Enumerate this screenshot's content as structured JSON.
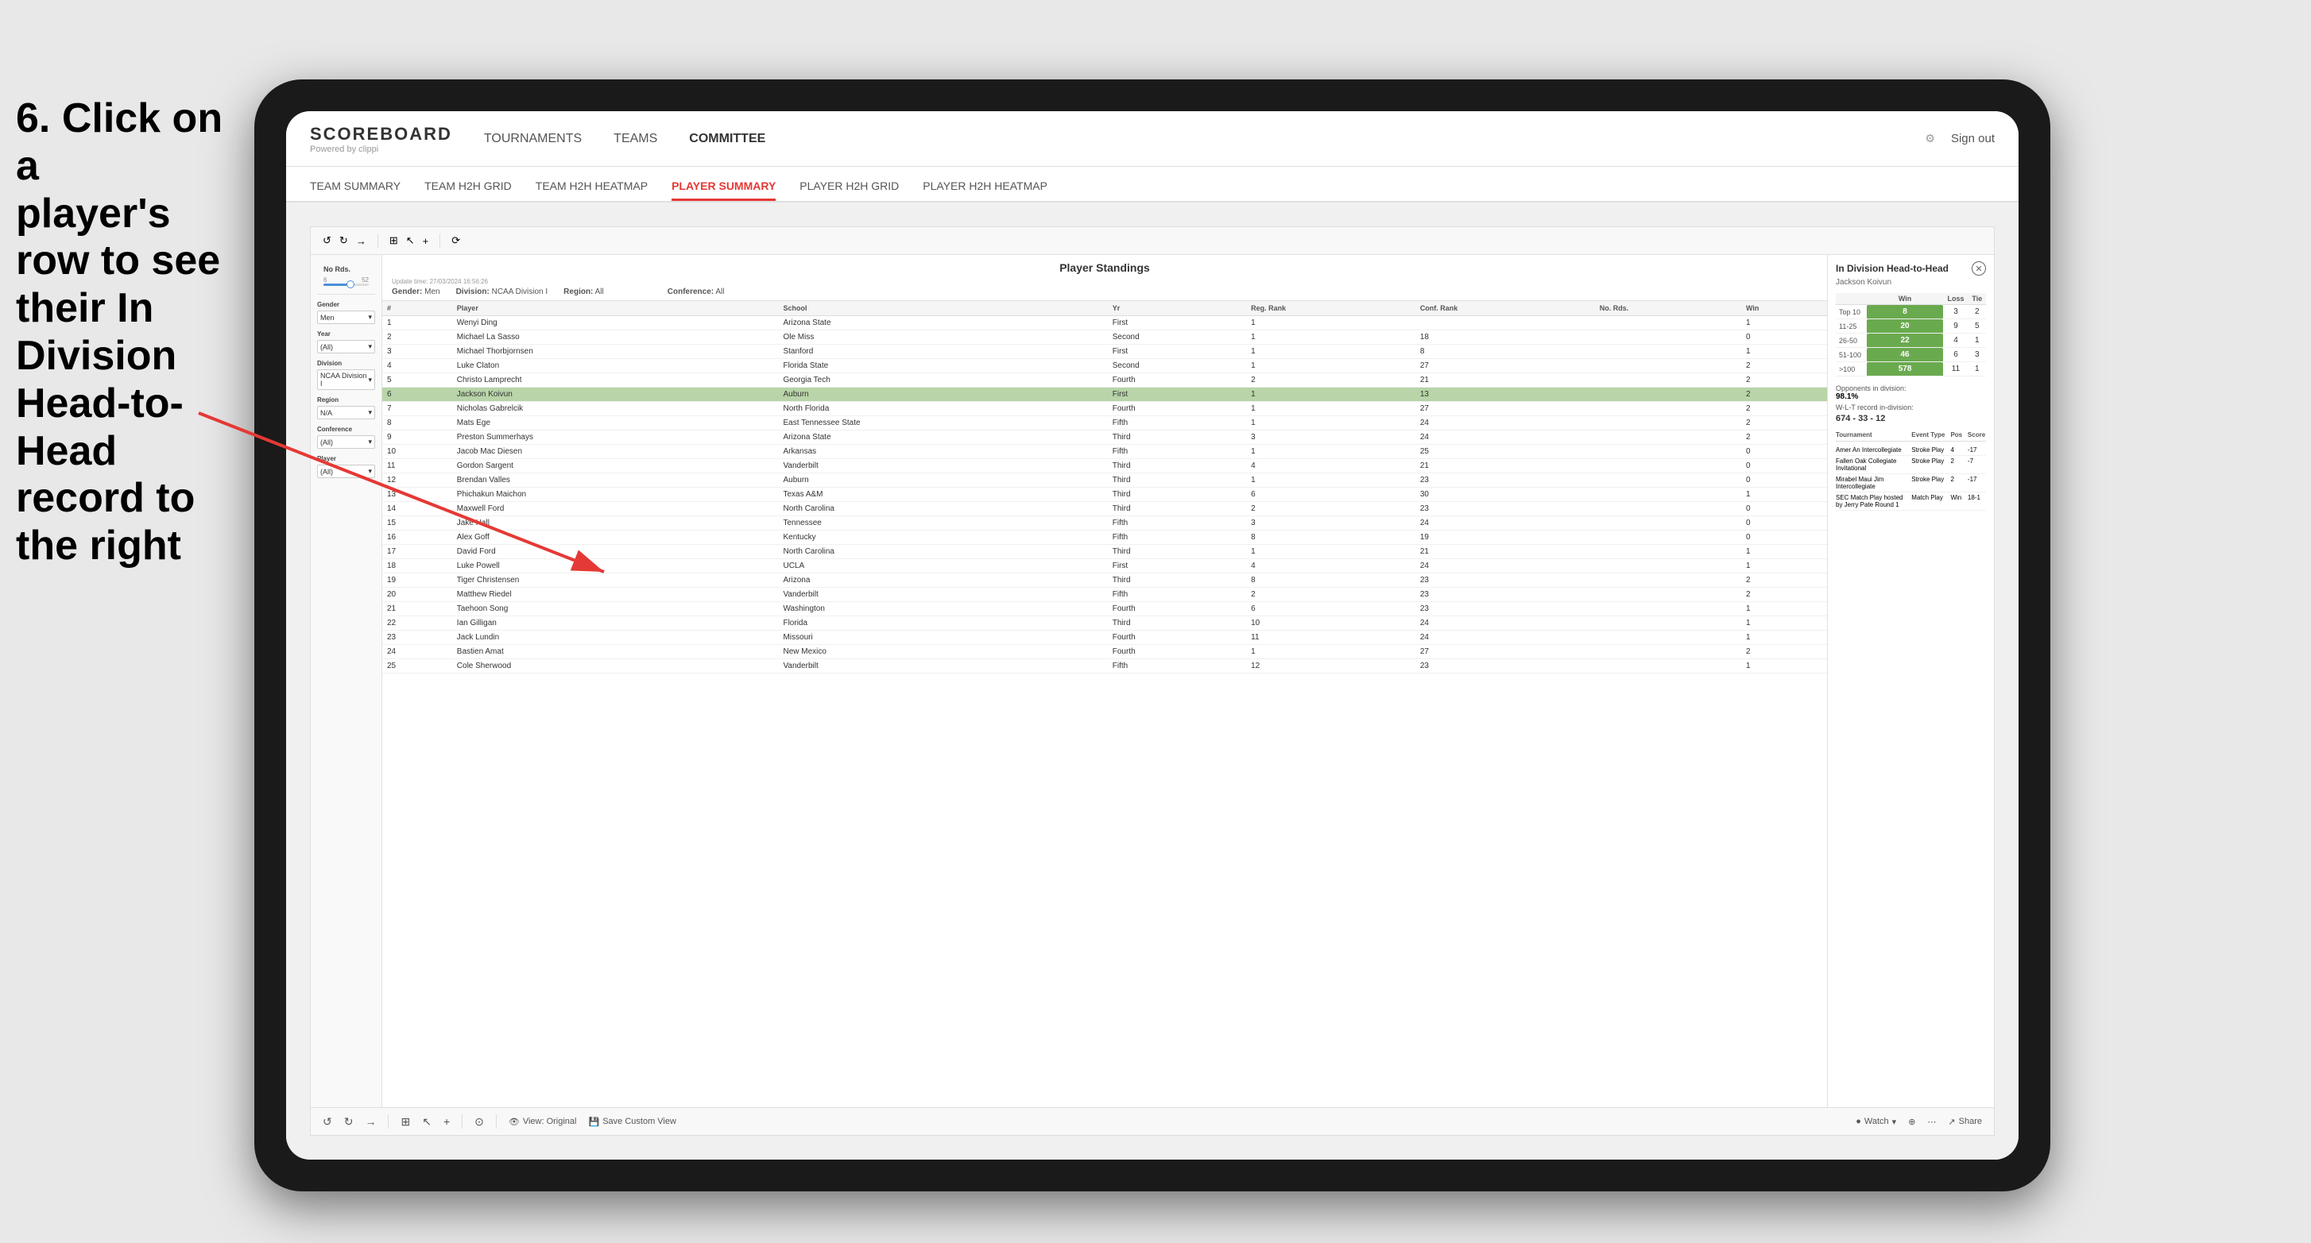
{
  "instruction": {
    "line1": "6. Click on a",
    "line2": "player's row to see",
    "line3": "their In Division",
    "line4": "Head-to-Head",
    "line5": "record to the right"
  },
  "nav": {
    "logo": "SCOREBOARD",
    "logo_sub": "Powered by clippi",
    "items": [
      "TOURNAMENTS",
      "TEAMS",
      "COMMITTEE"
    ],
    "sign_out": "Sign out"
  },
  "sub_nav": {
    "items": [
      "TEAM SUMMARY",
      "TEAM H2H GRID",
      "TEAM H2H HEATMAP",
      "PLAYER SUMMARY",
      "PLAYER H2H GRID",
      "PLAYER H2H HEATMAP"
    ],
    "active": "PLAYER SUMMARY"
  },
  "standings": {
    "title": "Player Standings",
    "update_time": "Update time:",
    "update_date": "27/03/2024 16:56:26",
    "gender_label": "Gender:",
    "gender_value": "Men",
    "division_label": "Division:",
    "division_value": "NCAA Division I",
    "region_label": "Region:",
    "region_value": "All",
    "conference_label": "Conference:",
    "conference_value": "All",
    "columns": [
      "#",
      "Player",
      "School",
      "Yr",
      "Reg. Rank",
      "Conf. Rank",
      "No. Rds.",
      "Win"
    ],
    "players": [
      {
        "num": 1,
        "name": "Wenyi Ding",
        "school": "Arizona State",
        "yr": "First",
        "reg": 1,
        "conf": "",
        "rds": "",
        "win": 1
      },
      {
        "num": 2,
        "name": "Michael La Sasso",
        "school": "Ole Miss",
        "yr": "Second",
        "reg": 1,
        "conf": 18,
        "rds": "",
        "win": 0
      },
      {
        "num": 3,
        "name": "Michael Thorbjornsen",
        "school": "Stanford",
        "yr": "First",
        "reg": 1,
        "conf": 8,
        "rds": "",
        "win": 1
      },
      {
        "num": 4,
        "name": "Luke Claton",
        "school": "Florida State",
        "yr": "Second",
        "reg": 1,
        "conf": 27,
        "rds": "",
        "win": 2
      },
      {
        "num": 5,
        "name": "Christo Lamprecht",
        "school": "Georgia Tech",
        "yr": "Fourth",
        "reg": 2,
        "conf": 21,
        "rds": "",
        "win": 2
      },
      {
        "num": 6,
        "name": "Jackson Koivun",
        "school": "Auburn",
        "yr": "First",
        "reg": 1,
        "conf": 13,
        "rds": "",
        "win": 2,
        "highlighted": true
      },
      {
        "num": 7,
        "name": "Nicholas Gabrelcik",
        "school": "North Florida",
        "yr": "Fourth",
        "reg": 1,
        "conf": 27,
        "rds": "",
        "win": 2
      },
      {
        "num": 8,
        "name": "Mats Ege",
        "school": "East Tennessee State",
        "yr": "Fifth",
        "reg": 1,
        "conf": 24,
        "rds": "",
        "win": 2
      },
      {
        "num": 9,
        "name": "Preston Summerhays",
        "school": "Arizona State",
        "yr": "Third",
        "reg": 3,
        "conf": 24,
        "rds": "",
        "win": 2
      },
      {
        "num": 10,
        "name": "Jacob Mac Diesen",
        "school": "Arkansas",
        "yr": "Fifth",
        "reg": 1,
        "conf": 25,
        "rds": "",
        "win": 0
      },
      {
        "num": 11,
        "name": "Gordon Sargent",
        "school": "Vanderbilt",
        "yr": "Third",
        "reg": 4,
        "conf": 21,
        "rds": "",
        "win": 0
      },
      {
        "num": 12,
        "name": "Brendan Valles",
        "school": "Auburn",
        "yr": "Third",
        "reg": 1,
        "conf": 23,
        "rds": "",
        "win": 0
      },
      {
        "num": 13,
        "name": "Phichakun Maichon",
        "school": "Texas A&M",
        "yr": "Third",
        "reg": 6,
        "conf": 30,
        "rds": "",
        "win": 1
      },
      {
        "num": 14,
        "name": "Maxwell Ford",
        "school": "North Carolina",
        "yr": "Third",
        "reg": 2,
        "conf": 23,
        "rds": "",
        "win": 0
      },
      {
        "num": 15,
        "name": "Jake Hall",
        "school": "Tennessee",
        "yr": "Fifth",
        "reg": 3,
        "conf": 24,
        "rds": "",
        "win": 0
      },
      {
        "num": 16,
        "name": "Alex Goff",
        "school": "Kentucky",
        "yr": "Fifth",
        "reg": 8,
        "conf": 19,
        "rds": "",
        "win": 0
      },
      {
        "num": 17,
        "name": "David Ford",
        "school": "North Carolina",
        "yr": "Third",
        "reg": 1,
        "conf": 21,
        "rds": "",
        "win": 1
      },
      {
        "num": 18,
        "name": "Luke Powell",
        "school": "UCLA",
        "yr": "First",
        "reg": 4,
        "conf": 24,
        "rds": "",
        "win": 1
      },
      {
        "num": 19,
        "name": "Tiger Christensen",
        "school": "Arizona",
        "yr": "Third",
        "reg": 8,
        "conf": 23,
        "rds": "",
        "win": 2
      },
      {
        "num": 20,
        "name": "Matthew Riedel",
        "school": "Vanderbilt",
        "yr": "Fifth",
        "reg": 2,
        "conf": 23,
        "rds": "",
        "win": 2
      },
      {
        "num": 21,
        "name": "Taehoon Song",
        "school": "Washington",
        "yr": "Fourth",
        "reg": 6,
        "conf": 23,
        "rds": "",
        "win": 1
      },
      {
        "num": 22,
        "name": "Ian Gilligan",
        "school": "Florida",
        "yr": "Third",
        "reg": 10,
        "conf": 24,
        "rds": "",
        "win": 1
      },
      {
        "num": 23,
        "name": "Jack Lundin",
        "school": "Missouri",
        "yr": "Fourth",
        "reg": 11,
        "conf": 24,
        "rds": "",
        "win": 1
      },
      {
        "num": 24,
        "name": "Bastien Amat",
        "school": "New Mexico",
        "yr": "Fourth",
        "reg": 1,
        "conf": 27,
        "rds": "",
        "win": 2
      },
      {
        "num": 25,
        "name": "Cole Sherwood",
        "school": "Vanderbilt",
        "yr": "Fifth",
        "reg": 12,
        "conf": 23,
        "rds": "",
        "win": 1
      }
    ]
  },
  "h2h": {
    "title": "In Division Head-to-Head",
    "player": "Jackson Koivun",
    "table_headers": [
      "Win",
      "Loss",
      "Tie"
    ],
    "rows": [
      {
        "label": "Top 10",
        "win": 8,
        "loss": 3,
        "tie": 2
      },
      {
        "label": "11-25",
        "win": 20,
        "loss": 9,
        "tie": 5
      },
      {
        "label": "26-50",
        "win": 22,
        "loss": 4,
        "tie": 1
      },
      {
        "label": "51-100",
        "win": 46,
        "loss": 6,
        "tie": 3
      },
      {
        "label": ">100",
        "win": 578,
        "loss": 11,
        "tie": 1
      }
    ],
    "opponents_pct_label": "Opponents in division:",
    "opponents_pct": "98.1%",
    "wlt_label": "W-L-T record in-division:",
    "wlt": "674 - 33 - 12",
    "tournament_headers": [
      "Tournament",
      "Event Type",
      "Pos",
      "Score"
    ],
    "tournaments": [
      {
        "name": "Amer An Intercollegiate",
        "type": "Stroke Play",
        "pos": 4,
        "score": "-17"
      },
      {
        "name": "Fallen Oak Collegiate Invitational",
        "type": "Stroke Play",
        "pos": 2,
        "score": "-7"
      },
      {
        "name": "Mirabel Maui Jim Intercollegiate",
        "type": "Stroke Play",
        "pos": 2,
        "score": "-17"
      },
      {
        "name": "SEC Match Play hosted by Jerry Pate Round 1",
        "type": "Match Play",
        "pos": "Win",
        "score": "18-1"
      }
    ]
  },
  "filters": {
    "no_rds_label": "No Rds.",
    "gender_label": "Gender",
    "gender_value": "Men",
    "year_label": "Year",
    "year_value": "(All)",
    "division_label": "Division",
    "division_value": "NCAA Division I",
    "region_label": "Region",
    "region_value": "N/A",
    "conference_label": "Conference",
    "conference_value": "(All)",
    "player_label": "Player",
    "player_value": "(All)"
  },
  "toolbar": {
    "view_original": "View: Original",
    "save_custom": "Save Custom View",
    "watch": "Watch",
    "share": "Share"
  }
}
